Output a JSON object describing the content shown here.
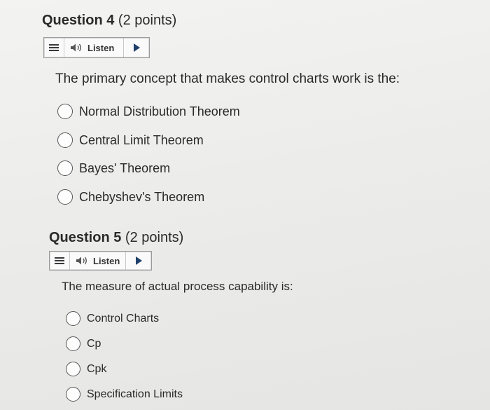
{
  "questions": [
    {
      "number_label": "Question 4",
      "points_label": "(2 points)",
      "listen_label": "Listen",
      "prompt": "The primary concept that makes control charts work is the:",
      "options": [
        "Normal Distribution Theorem",
        "Central Limit Theorem",
        "Bayes' Theorem",
        "Chebyshev's Theorem"
      ]
    },
    {
      "number_label": "Question 5",
      "points_label": "(2 points)",
      "listen_label": "Listen",
      "prompt": "The measure of actual process capability is:",
      "options": [
        "Control Charts",
        "Cp",
        "Cpk",
        "Specification Limits"
      ]
    }
  ],
  "colors": {
    "play_icon": "#1e3f6a",
    "text": "#2a2a2a"
  }
}
